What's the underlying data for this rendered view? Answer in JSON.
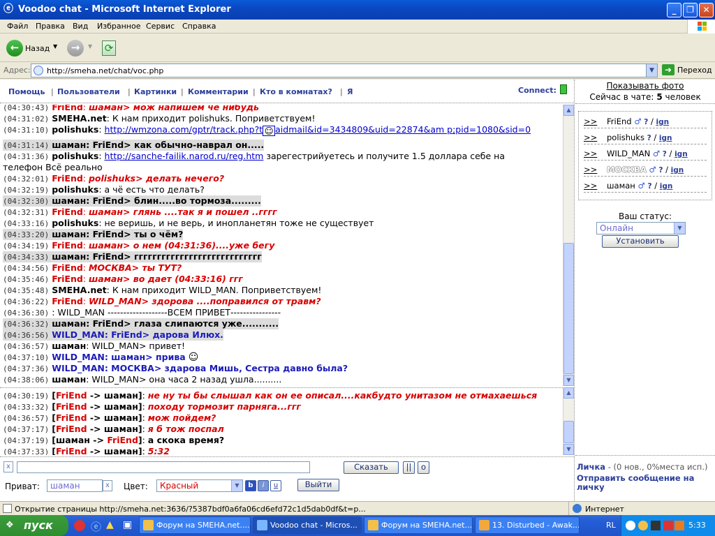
{
  "window": {
    "title": "Voodoo chat - Microsoft Internet Explorer"
  },
  "menu": [
    "Файл",
    "Правка",
    "Вид",
    "Избранное",
    "Сервис",
    "Справка"
  ],
  "toolbar": {
    "back_label": "Назад"
  },
  "address": {
    "label": "Адрес:",
    "url": "http://smeha.net/chat/voc.php",
    "go_label": "Переход"
  },
  "chatnav": {
    "links": [
      "Помощь",
      "Пользователи",
      "Картинки",
      "Комментарии",
      "Кто в комнатах?",
      "Я"
    ],
    "connect_label": "Connect:"
  },
  "messages": [
    {
      "time": "(04:30:43)",
      "nick": "FriEnd",
      "text": "шаман> мож напишем че нибудь",
      "style": "red"
    },
    {
      "time": "(04:31:02)",
      "nick": "SMEHA.net",
      "text": ": К нам приходит polishuks. Поприветствуем!",
      "style": "black"
    },
    {
      "time": "(04:31:10)",
      "nick": "polishuks",
      "sep": ":",
      "link": "http://wmzona.com/gptr/track.php?t",
      "link2": "aidmail&id=3434809&uid=22874&am p;pid=1080&sid=0",
      "style": "link"
    },
    {
      "time": "(04:31:14)",
      "nick": "шаман",
      "text": ": FriEnd> как обычно-наврал он.....",
      "style": "grey"
    },
    {
      "time": "(04:31:36)",
      "nick": "polishuks",
      "sep": ":",
      "link": "http://sanche-failik.narod.ru/reg.htm",
      "text": " зарегестрийуетесь и получите 1.5 доллара себе на",
      "cont": "телефон Всё реально",
      "style": "link"
    },
    {
      "time": "(04:32:01)",
      "nick": "FriEnd",
      "text": "polishuks> делать нечего?",
      "style": "red"
    },
    {
      "time": "(04:32:19)",
      "nick": "polishuks",
      "text": ": а чё есть что делать?",
      "style": "black"
    },
    {
      "time": "(04:32:30)",
      "nick": "шаман",
      "text": ": FriEnd> блин.....во тормоза.........",
      "style": "grey"
    },
    {
      "time": "(04:32:31)",
      "nick": "FriEnd",
      "text": "шаман> глянь ....так я и пошел ..гггг",
      "style": "red"
    },
    {
      "time": "(04:33:16)",
      "nick": "polishuks",
      "text": ": не веришь, и не верь, и инопланетян тоже не существует",
      "style": "black"
    },
    {
      "time": "(04:33:20)",
      "nick": "шаман",
      "text": ": FriEnd> ты о чём?",
      "style": "grey"
    },
    {
      "time": "(04:34:19)",
      "nick": "FriEnd",
      "text": "шаман> о нем (04:31:36)....уже бегу",
      "style": "red"
    },
    {
      "time": "(04:34:33)",
      "nick": "шаман",
      "text": ": FriEnd> гггггггггггггггггггггггггггг",
      "style": "grey"
    },
    {
      "time": "(04:34:56)",
      "nick": "FriEnd",
      "text": "МОСКВА> ты ТУТ?",
      "style": "red"
    },
    {
      "time": "(04:35:46)",
      "nick": "FriEnd",
      "text": "шаман> во дает (04:33:16) ггг",
      "style": "red"
    },
    {
      "time": "(04:35:48)",
      "nick": "SMEHA.net",
      "text": ": К нам приходит WILD_MAN. Поприветствуем!",
      "style": "black"
    },
    {
      "time": "(04:36:22)",
      "nick": "FriEnd",
      "text": "WILD_MAN> здорова ....поправился от травм?",
      "style": "red"
    },
    {
      "time": "(04:36:30)",
      "nick": "",
      "text": ": WILD_MAN -------------------ВСЕМ ПРИВЕТ----------------",
      "style": "black"
    },
    {
      "time": "(04:36:32)",
      "nick": "шаман",
      "text": ": FriEnd> глаза слипаются уже...........",
      "style": "grey"
    },
    {
      "time": "(04:36:56)",
      "nick": "WILD_MAN",
      "text": ": FriEnd> дарова Илюх.",
      "style": "bluehl"
    },
    {
      "time": "(04:36:57)",
      "nick": "шаман",
      "text": ": WILD_MAN> привет!",
      "style": "black"
    },
    {
      "time": "(04:37:10)",
      "nick": "WILD_MAN",
      "text": ": шаман> прива",
      "style": "blue"
    },
    {
      "time": "(04:37:36)",
      "nick": "WILD_MAN",
      "text": ": МОСКВА> здарова Мишь, Сестра давно была?",
      "style": "blue"
    },
    {
      "time": "(04:38:06)",
      "nick": "шаман",
      "text": ": WILD_MAN> она часа 2 назад ушла..........",
      "style": "black"
    }
  ],
  "private_messages": [
    {
      "time": "(04:30:19)",
      "from": "FriEnd",
      "to": "шаман",
      "text": "не ну ты бы слышал как он ее описал....какбудто унитазом не отмахаешься",
      "style": "red"
    },
    {
      "time": "(04:33:32)",
      "from": "FriEnd",
      "to": "шаман",
      "text": "походу тормозит парняга...ггг",
      "style": "red"
    },
    {
      "time": "(04:36:57)",
      "from": "FriEnd",
      "to": "шаман",
      "text": "мож пойдем?",
      "style": "red"
    },
    {
      "time": "(04:37:17)",
      "from": "FriEnd",
      "to": "шаман",
      "text": "я б тож поспал",
      "style": "red"
    },
    {
      "time": "(04:37:19)",
      "from": "шаман",
      "to": "FriEnd",
      "text": "а скока время?",
      "style": "black"
    },
    {
      "time": "(04:37:33)",
      "from": "FriEnd",
      "to": "шаман",
      "text": "5:32",
      "style": "red"
    }
  ],
  "form": {
    "send_label": "Сказать",
    "btn_pause": "||",
    "btn_o": "o",
    "clear_x": "x",
    "private_label": "Приват:",
    "private_value": "шаман",
    "color_label": "Цвет:",
    "color_value": "Красный",
    "bold": "b",
    "italic": "i",
    "underline": "u",
    "exit_label": "Выйти"
  },
  "right": {
    "show_photo": "Показывать фото",
    "now_in_chat_pre": "Сейчас в чате:",
    "now_in_chat_count": "5",
    "now_in_chat_post": "человек",
    "users": [
      {
        "arrow": ">>",
        "name": "FriEnd",
        "gender": "♂",
        "q": "?",
        "slash": "/",
        "ign": "ign"
      },
      {
        "arrow": ">>",
        "name": "polishuks",
        "gender": "",
        "q": "?",
        "slash": "/",
        "ign": "ign"
      },
      {
        "arrow": ">>",
        "name": "WILD_MAN",
        "gender": "♂",
        "q": "?",
        "slash": "/",
        "ign": "ign"
      },
      {
        "arrow": ">>",
        "name": "МОСКВА",
        "gender": "♂",
        "q": "?",
        "slash": "/",
        "ign": "ign"
      },
      {
        "arrow": ">>",
        "name": "шаман",
        "gender": "♂",
        "q": "?",
        "slash": "/",
        "ign": "ign"
      }
    ],
    "status_label": "Ваш статус:",
    "status_value": "Онлайн",
    "set_label": "Установить",
    "lichka_label": "Личка",
    "lichka_info": " - (0 нов., 0%места исп.)",
    "send_private": "Отправить сообщение на личку"
  },
  "statusbar": {
    "text": "Открытие страницы http://smeha.net:3636/?5387bdf0a6fa06cd6efd72c1d5dab0df&t=p...",
    "zone": "Интернет"
  },
  "taskbar": {
    "start": "пуск",
    "tasks": [
      "Форум на SMEHA.net....",
      "Voodoo chat - Micros...",
      "Форум на SMEHA.net....",
      "13. Disturbed - Awak..."
    ],
    "lang": "RL",
    "clock": "5:33"
  }
}
